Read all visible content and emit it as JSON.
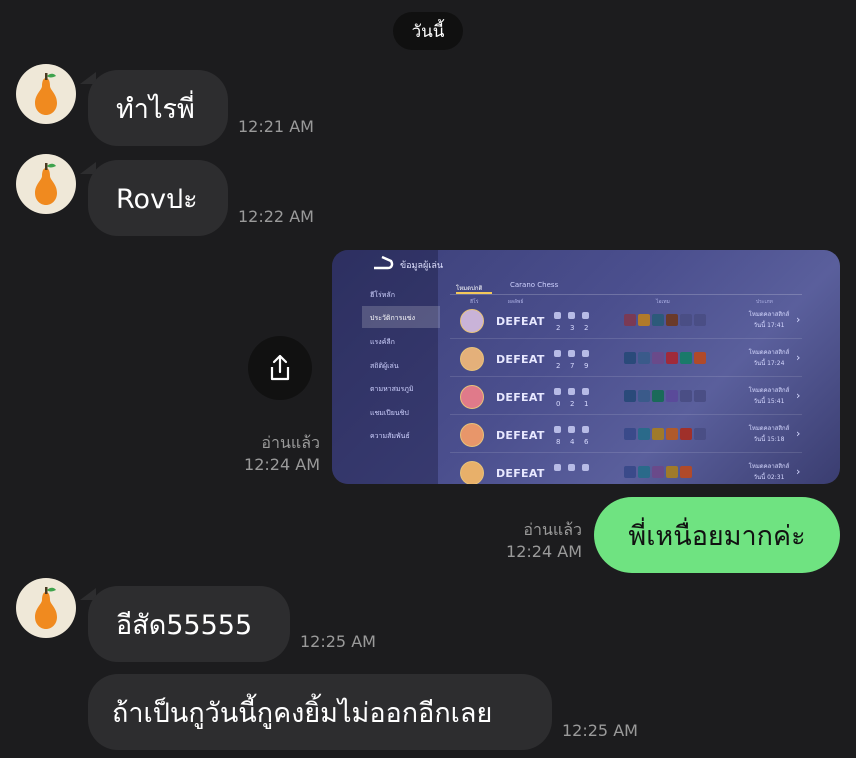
{
  "date_label": "วันนี้",
  "messages": [
    {
      "text": "ทำไรพี่",
      "time": "12:21 AM"
    },
    {
      "text": "Rovปะ",
      "time": "12:22 AM"
    },
    {
      "read": "อ่านแล้ว",
      "time": "12:24 AM"
    },
    {
      "text": "พี่เหนื่อยมากค่ะ",
      "read": "อ่านแล้ว",
      "time": "12:24 AM"
    },
    {
      "text": "อีสัด55555",
      "time": "12:25 AM"
    },
    {
      "text": "ถ้าเป็นกูวันนี้กูคงยิ้มไม่ออกอีกเลย",
      "time": "12:25 AM"
    }
  ],
  "game_screenshot": {
    "header": "ข้อมูลผู้เล่น",
    "tabs": [
      "โหมดปกติ",
      "Carano Chess"
    ],
    "columns": [
      "ฮีโร่",
      "ผลลัพธ์",
      "ไอเทม",
      "ประเภท"
    ],
    "sidebar": [
      "ฮีโร่หลัก",
      "ประวัติการแข่ง",
      "แรงค์ลีก",
      "สถิติผู้เล่น",
      "ตามหาสมรภูมิ",
      "แชมเปียนชิป",
      "ความสัมพันธ์"
    ],
    "rows": [
      {
        "result": "DEFEAT",
        "k": "2",
        "d": "3",
        "a": "2",
        "mode": "โหมดคลาสสิกส์",
        "time": "วันนี้ 17:41"
      },
      {
        "result": "DEFEAT",
        "k": "2",
        "d": "7",
        "a": "9",
        "mode": "โหมดคลาสสิกส์",
        "time": "วันนี้ 17:24"
      },
      {
        "result": "DEFEAT",
        "k": "0",
        "d": "2",
        "a": "1",
        "mode": "โหมดคลาสสิกส์",
        "time": "วันนี้ 15:41"
      },
      {
        "result": "DEFEAT",
        "k": "8",
        "d": "4",
        "a": "6",
        "mode": "โหมดคลาสสิกส์",
        "time": "วันนี้ 15:18"
      },
      {
        "result": "DEFEAT",
        "k": "",
        "d": "",
        "a": "",
        "mode": "โหมดคลาสสิกส์",
        "time": "วันนี้ 02:31"
      }
    ]
  },
  "colors": {
    "background": "#1c1c1e",
    "incoming_bubble": "#2d2d2f",
    "outgoing_bubble": "#6fe381"
  },
  "icons": {
    "avatar": "pear-icon",
    "share": "share-icon"
  }
}
